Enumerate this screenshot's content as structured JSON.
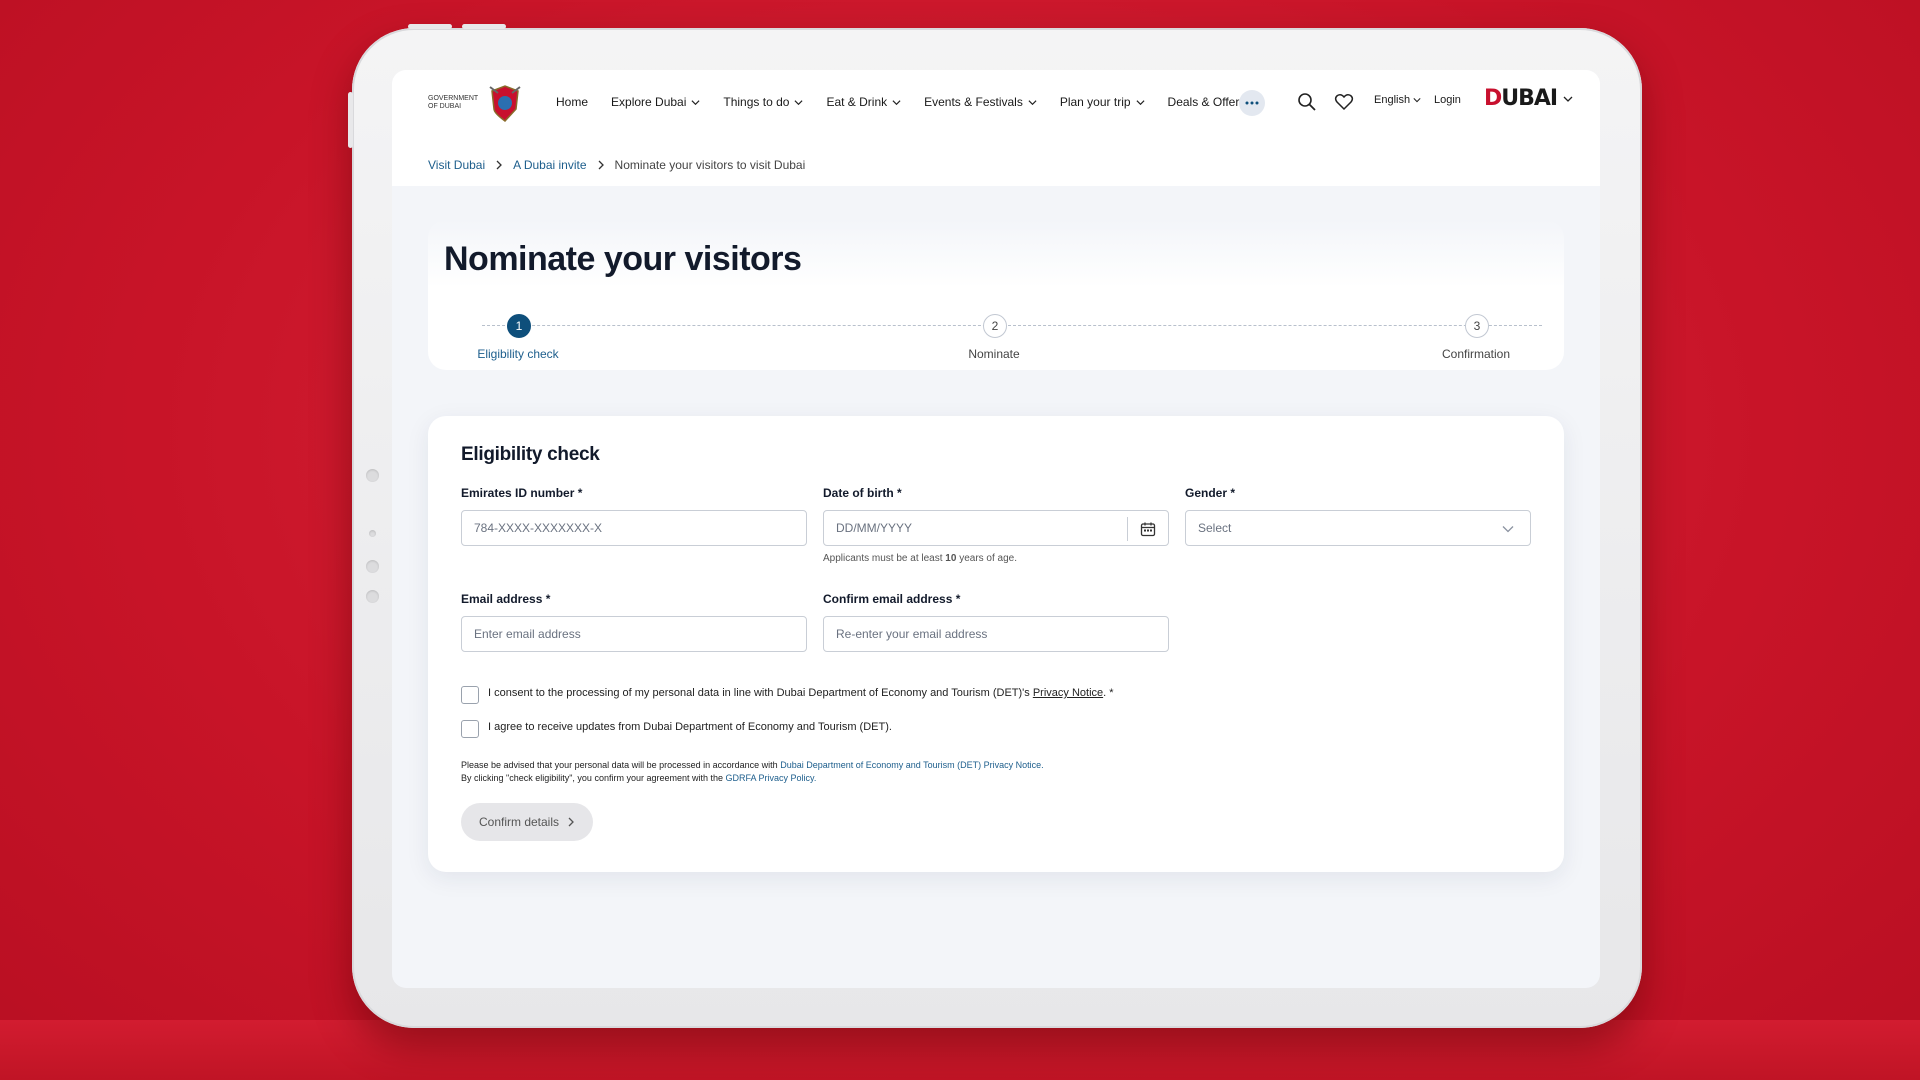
{
  "nav": {
    "menu": [
      {
        "label": "Home",
        "dropdown": false
      },
      {
        "label": "Explore Dubai",
        "dropdown": true
      },
      {
        "label": "Things to do",
        "dropdown": true
      },
      {
        "label": "Eat & Drink",
        "dropdown": true
      },
      {
        "label": "Events & Festivals",
        "dropdown": true
      },
      {
        "label": "Plan your trip",
        "dropdown": true
      },
      {
        "label": "Deals & Offers",
        "dropdown": true
      }
    ],
    "more_icon": "ellipsis-icon",
    "search_icon": "search-icon",
    "favorites_icon": "heart-icon",
    "language": "English",
    "login": "Login",
    "brand_logo": "DUBAI",
    "gov_logo_text": "GOVERNMENT OF DUBAI"
  },
  "breadcrumb": {
    "items": [
      "Visit Dubai",
      "A Dubai invite"
    ],
    "current": "Nominate your visitors to visit Dubai"
  },
  "page": {
    "title": "Nominate your visitors",
    "steps": [
      {
        "number": "1",
        "label": "Eligibility check",
        "active": true
      },
      {
        "number": "2",
        "label": "Nominate",
        "active": false
      },
      {
        "number": "3",
        "label": "Confirmation",
        "active": false
      }
    ]
  },
  "form": {
    "title": "Eligibility check",
    "emirates_id": {
      "label": "Emirates ID number *",
      "placeholder": "784-XXXX-XXXXXXX-X"
    },
    "dob": {
      "label": "Date of birth *",
      "placeholder": "DD/MM/YYYY",
      "hint_pre": "Applicants must be at least ",
      "hint_num": "10",
      "hint_post": " years of age."
    },
    "gender": {
      "label": "Gender *",
      "value": "Select"
    },
    "email": {
      "label": "Email address *",
      "placeholder": "Enter email address"
    },
    "confirm_email": {
      "label": "Confirm email address *",
      "placeholder": "Re-enter your email address"
    },
    "consent1": {
      "text": "I consent to the processing of my personal data in line with Dubai Department of Economy and Tourism (DET)'s ",
      "link": "Privacy Notice",
      "suffix": ". *"
    },
    "consent2": {
      "text": "I agree to receive updates from Dubai Department of Economy and Tourism (DET)."
    },
    "note_line1_pre": "Please be advised that your personal data will be processed in accordance with ",
    "note_line1_link": "Dubai Department of Economy and Tourism (DET) Privacy Notice.",
    "note_line2_pre": "By clicking \"check eligibility\", you confirm your agreement with the ",
    "note_line2_link": "GDRFA Privacy Policy.",
    "submit": "Confirm details"
  },
  "colors": {
    "background": "#c81428",
    "accent": "#0e4f7b",
    "link": "#1d5e8c"
  }
}
